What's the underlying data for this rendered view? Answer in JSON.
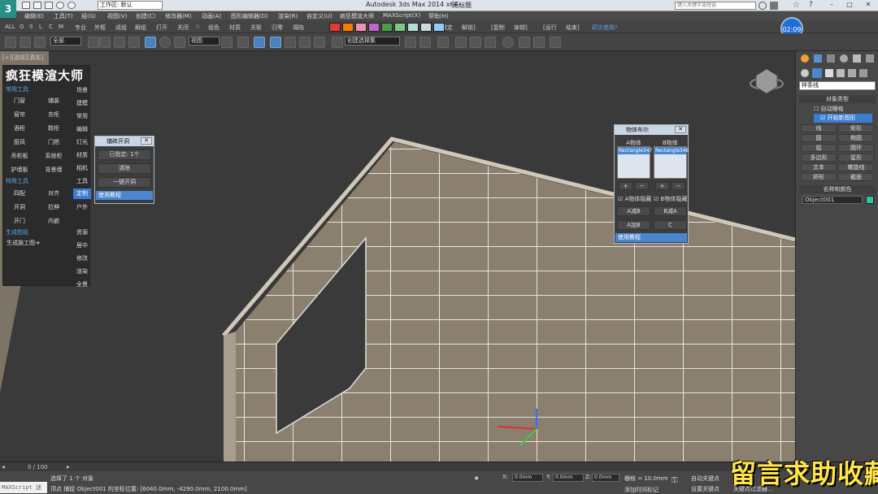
{
  "window": {
    "app_title": "Autodesk 3ds Max  2014 x64",
    "doc_title": "无标题",
    "workspace": "工作区: 默认",
    "search_placeholder": "键入关键字或短语"
  },
  "menu": [
    "编辑(E)",
    "工具(T)",
    "组(G)",
    "视图(V)",
    "创建(C)",
    "修改器(M)",
    "动画(A)",
    "图形编辑器(D)",
    "渲染(R)",
    "自定义(U)",
    "疯狂模渲大师",
    "MAXScript(X)",
    "帮助(H)"
  ],
  "row2": {
    "letters": [
      "ALL",
      "G",
      "S",
      "L",
      "C",
      "M"
    ],
    "labels": [
      "专业",
      "外框",
      "成组",
      "解组",
      "打开",
      "关闭",
      "☆",
      "组色",
      "材质",
      "关联",
      "归零",
      "塌陷"
    ],
    "right_labels": [
      "[锁定",
      "解锁]",
      "[复制",
      "穿越]",
      "[运行",
      "结束]",
      "初次使用?"
    ],
    "swatch_colors": [
      "#e53935",
      "#f57c00",
      "#f48fb1",
      "#ba68c8",
      "#43a047",
      "#81c784",
      "#b2dfdb",
      "#cfd8dc",
      "#90caf9"
    ]
  },
  "toolbar": {
    "filter": "全部",
    "view": "视图",
    "selset": "创建选择集"
  },
  "clock": "02:09",
  "viewport": {
    "label": "[+][透视][真实]"
  },
  "plugin": {
    "title": "疯狂模渲大师",
    "sec_common": "常用工具",
    "btns": [
      "门窗",
      "铺装",
      "窗帘",
      "衣柜",
      "酒柜",
      "鞋柜",
      "厨风",
      "门把",
      "吊柜板",
      "系统柜",
      "护墙板",
      "背景墙"
    ],
    "sec_special": "特殊工具",
    "btns2": [
      "四配",
      "对齐",
      "开洞",
      "拉伸",
      "开门",
      "内嵌"
    ],
    "sec_gen": "生成图纸",
    "gen": "生成施工图➔",
    "side": [
      "场景",
      "建模",
      "常用",
      "编辑",
      "灯光",
      "材质",
      "相机",
      "工具",
      "定制",
      "户外",
      "资源",
      "居中",
      "修改",
      "渲染",
      "全景"
    ],
    "side_active": "定制"
  },
  "dlg_hole": {
    "title": "铺砖开洞",
    "specified": "已指定: 1个",
    "clear": "清除",
    "one_key": "一键开洞",
    "tutorial": "使用教程"
  },
  "dlg_bool": {
    "title": "物体布尔",
    "a_obj": "A物体",
    "b_obj": "B物体",
    "a_item": "Rectangle347",
    "b_item": "Rectangle348",
    "plus": "+",
    "minus": "−",
    "a_hide": "A物体隐藏",
    "b_hide": "B物体隐藏",
    "a_minus_b": "A减B",
    "b_minus_a": "B减A",
    "a_plus_b": "A加B",
    "c": "C",
    "tutorial": "使用教程"
  },
  "cmd": {
    "dropdown": "样条线",
    "rollout1": "对象类型",
    "autogrid": "自动栅格",
    "start_new": "开始新图形",
    "shapes": [
      "线",
      "矩形",
      "圆",
      "椭圆",
      "弧",
      "圆环",
      "多边形",
      "星形",
      "文本",
      "螺旋线",
      "卵形",
      "截面"
    ],
    "rollout2": "名称和颜色",
    "obj_name": "Object001",
    "obj_color": "#2ec4a0"
  },
  "timeline": {
    "range": "0 / 100"
  },
  "status": {
    "script": "MAXScript 迷",
    "selected": "选择了 1 个 对象",
    "prompt": "顶点 捕捉 Object001 的坐标位置: [6040.0mm, -4290.0mm, 2100.0mm]",
    "x": "0.0mm",
    "y": "0.0mm",
    "z": "0.0mm",
    "grid": "栅格 = 10.0mm",
    "addtime": "添加时间标记",
    "autokey": "自动关键点",
    "setkey": "设置关键点",
    "keyfilter": "关键点过滤器...",
    "selobj": "选定对象"
  },
  "overlay": "留言求助收藏"
}
